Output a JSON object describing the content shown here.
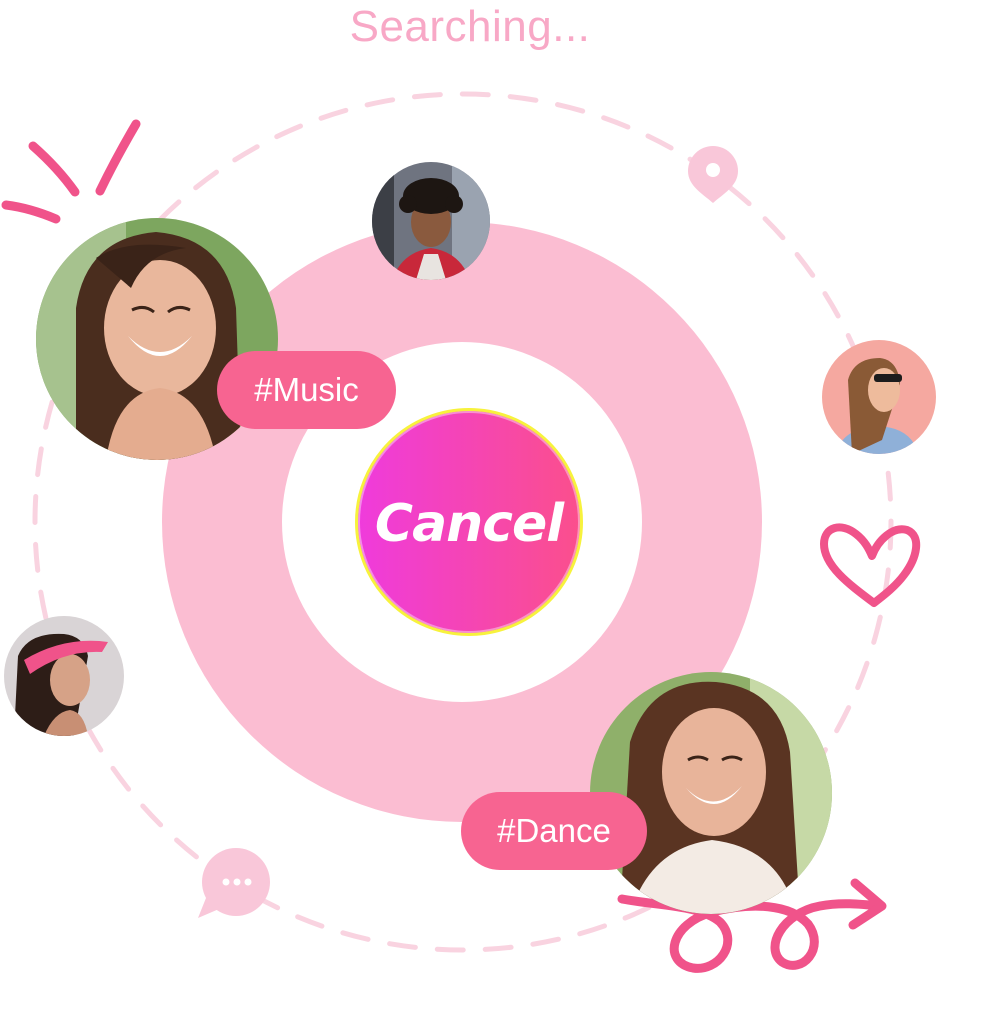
{
  "status": {
    "title": "Searching..."
  },
  "actions": {
    "cancel_label": "Cancel"
  },
  "tags": [
    {
      "label": "#Music"
    },
    {
      "label": "#Dance"
    }
  ],
  "colors": {
    "ring": "#fbbdd2",
    "tag": "#f76491",
    "accent": "#f0538a",
    "title": "#f8a8c6",
    "dashed_orbit": "#f9d3e0",
    "button_gradient_start": "#ef3bdc",
    "button_gradient_end": "#fb4f8c",
    "button_border": "#f7f23d"
  },
  "icons": [
    "location-pin-icon",
    "chat-bubble-icon",
    "heart-icon",
    "curly-arrow-icon",
    "sparkle-lines-icon"
  ],
  "avatars": [
    "avatar-woman-laughing",
    "avatar-man-curly-hair",
    "avatar-woman-sunglasses",
    "avatar-woman-visor",
    "avatar-woman-smiling"
  ]
}
